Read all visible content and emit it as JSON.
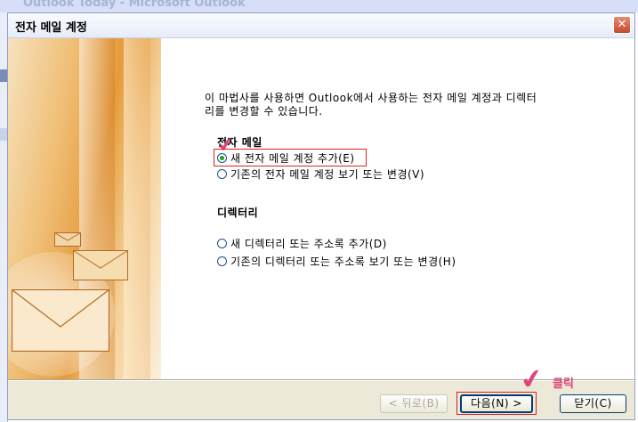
{
  "background_window": {
    "title": "Outlook Today - Microsoft Outlook"
  },
  "dialog": {
    "title": "전자 메일 계정",
    "close_glyph": "✕",
    "intro": "이 마법사를 사용하면 Outlook에서 사용하는 전자 메일 계정과 디렉터리를 변경할 수 있습니다.",
    "email_section": {
      "heading": "전자 메일",
      "options": [
        {
          "label": "새 전자 메일 계정 추가(E)",
          "selected": true
        },
        {
          "label": "기존의 전자 메일 계정 보기 또는 변경(V)",
          "selected": false
        }
      ]
    },
    "directory_section": {
      "heading": "디렉터리",
      "options": [
        {
          "label": "새 디렉터리 또는 주소록 추가(D)",
          "selected": false
        },
        {
          "label": "기존의 디렉터리 또는 주소록 보기 또는 변경(H)",
          "selected": false
        }
      ]
    },
    "buttons": {
      "back": "< 뒤로(B)",
      "next": "다음(N) >",
      "close": "닫기(C)"
    },
    "annotation": {
      "click_label": "클릭",
      "check_glyph": "✔"
    }
  },
  "colors": {
    "annotation": "#e0447a",
    "highlight_border": "#dd2222",
    "radio_selected": "#21a121"
  }
}
